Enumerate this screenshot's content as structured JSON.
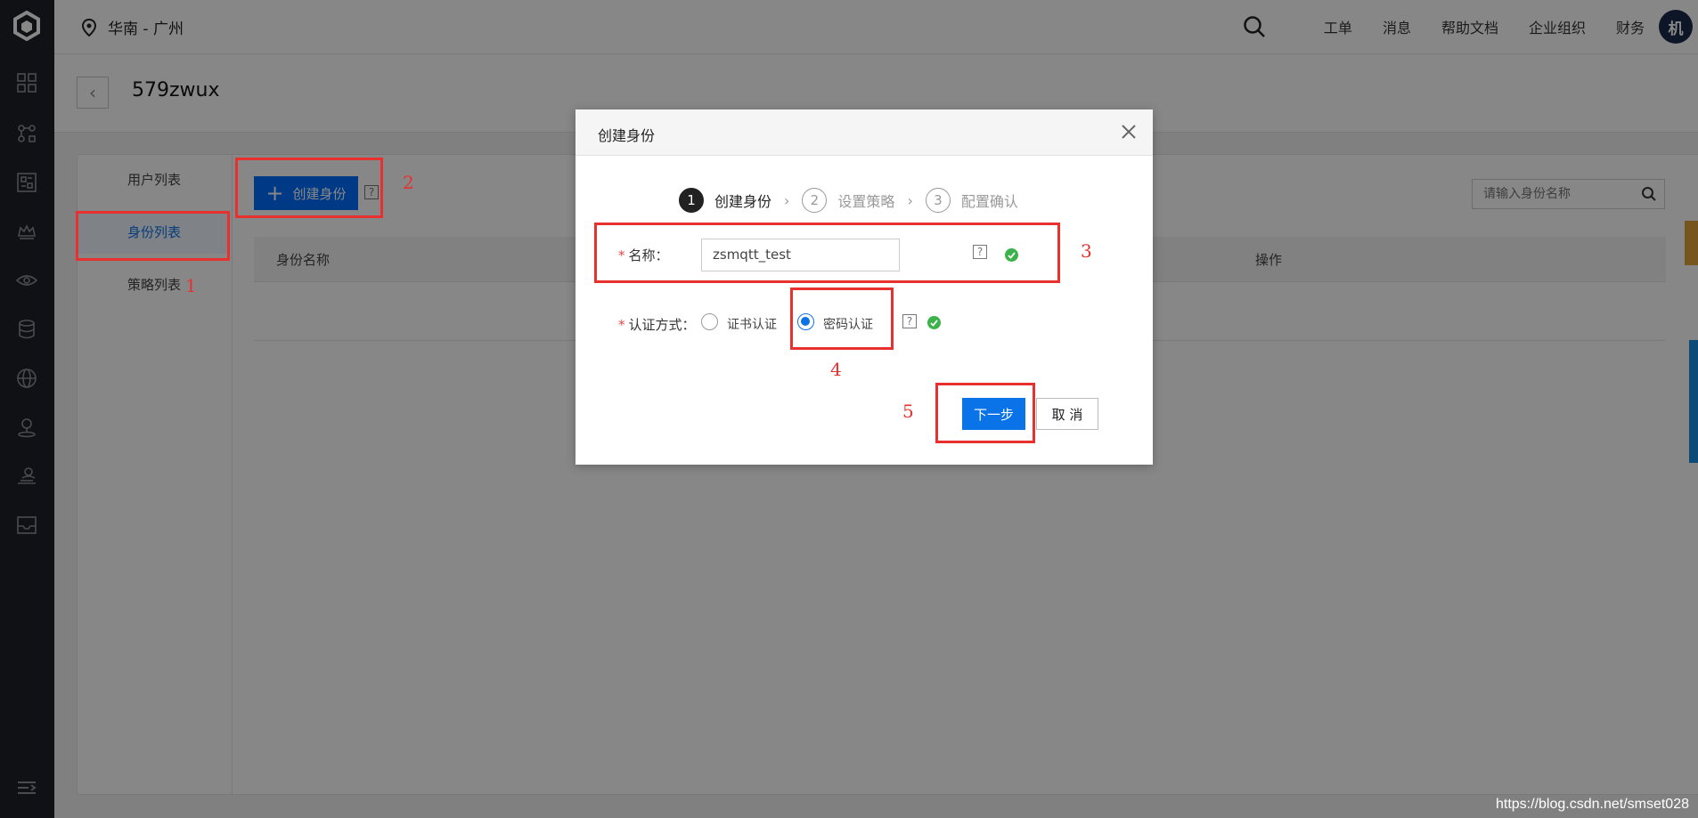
{
  "topbar": {
    "region": "华南 - 广州",
    "nav": [
      "工单",
      "消息",
      "帮助文档",
      "企业组织",
      "财务"
    ],
    "avatar_text": "机"
  },
  "page": {
    "title": "579zwux"
  },
  "subnav": {
    "items": [
      "用户列表",
      "身份列表",
      "策略列表"
    ],
    "active": "身份列表"
  },
  "toolbar": {
    "create_label": "创建身份",
    "search_placeholder": "请输入身份名称"
  },
  "table": {
    "headers": [
      "身份名称",
      "操作"
    ]
  },
  "dialog": {
    "title": "创建身份",
    "steps": [
      {
        "num": "1",
        "label": "创建身份",
        "active": true
      },
      {
        "num": "2",
        "label": "设置策略",
        "active": false
      },
      {
        "num": "3",
        "label": "配置确认",
        "active": false
      }
    ],
    "name_label": "名称：",
    "name_value": "zsmqtt_test",
    "auth_label": "认证方式：",
    "auth_options": [
      "证书认证",
      "密码认证"
    ],
    "auth_selected": "密码认证",
    "next_label": "下一步",
    "cancel_label": "取 消"
  },
  "annotations": [
    "1",
    "2",
    "3",
    "4",
    "5"
  ],
  "watermark": "https://blog.csdn.net/smset028",
  "colors": {
    "primary": "#006eff",
    "annotation": "#e8312f",
    "success": "#3cb34a",
    "sidebar": "#1e2128"
  }
}
